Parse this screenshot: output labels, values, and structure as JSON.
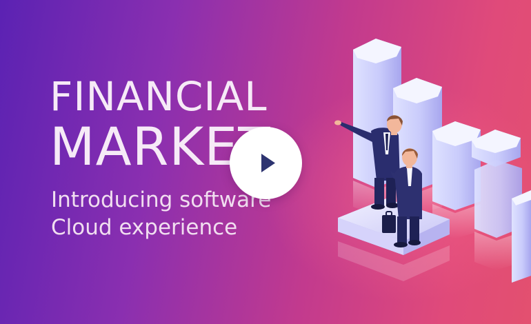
{
  "hero": {
    "title_line1": "FINANCIAL",
    "title_line2": "MARKET",
    "subtitle_line1": "Introducing software",
    "subtitle_line2": "Cloud experience"
  },
  "video": {
    "play_icon": "play-icon"
  },
  "colors": {
    "gradient_start": "#5b22b3",
    "gradient_end": "#e3506f",
    "column_light": "#e9ecff",
    "column_shade": "#a9a9ee",
    "suit": "#2a2d6e",
    "play_button": "#ffffff",
    "play_glyph": "#2d3470"
  }
}
